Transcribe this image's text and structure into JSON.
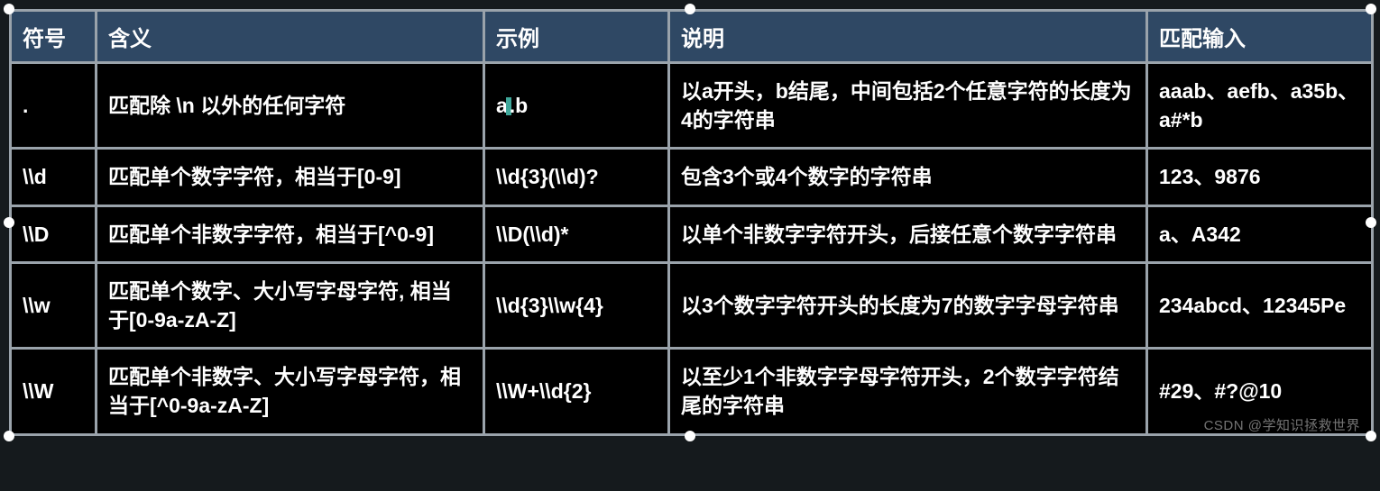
{
  "headers": [
    "符号",
    "含义",
    "示例",
    "说明",
    "匹配输入"
  ],
  "rows": [
    {
      "symbol": ".",
      "meaning": "匹配除 \\n 以外的任何字符",
      "example_pre": "a",
      "example_post": ".b",
      "has_cursor": true,
      "desc": "以a开头，b结尾，中间包括2个任意字符的长度为4的字符串",
      "match": "aaab、aefb、a35b、a#*b"
    },
    {
      "symbol": "\\\\d",
      "meaning": "匹配单个数字字符，相当于[0-9]",
      "example": "\\\\d{3}(\\\\d)?",
      "desc": "包含3个或4个数字的字符串",
      "match": "123、9876"
    },
    {
      "symbol": "\\\\D",
      "meaning": "匹配单个非数字字符，相当于[^0-9]",
      "example": "\\\\D(\\\\d)*",
      "desc": "以单个非数字字符开头，后接任意个数字字符串",
      "match": "a、A342"
    },
    {
      "symbol": "\\\\w",
      "meaning": "匹配单个数字、大小写字母字符, 相当于[0-9a-zA-Z]",
      "example": "\\\\d{3}\\\\w{4}",
      "desc": "以3个数字字符开头的长度为7的数字字母字符串",
      "match": "234abcd、12345Pe"
    },
    {
      "symbol": "\\\\W",
      "meaning": "匹配单个非数字、大小写字母字符，相当于[^0-9a-zA-Z]",
      "example": "\\\\W+\\\\d{2}",
      "desc": "以至少1个非数字字母字符开头，2个数字字符结尾的字符串",
      "match": "#29、#?@10"
    }
  ],
  "watermark": "CSDN @学知识拯救世界"
}
